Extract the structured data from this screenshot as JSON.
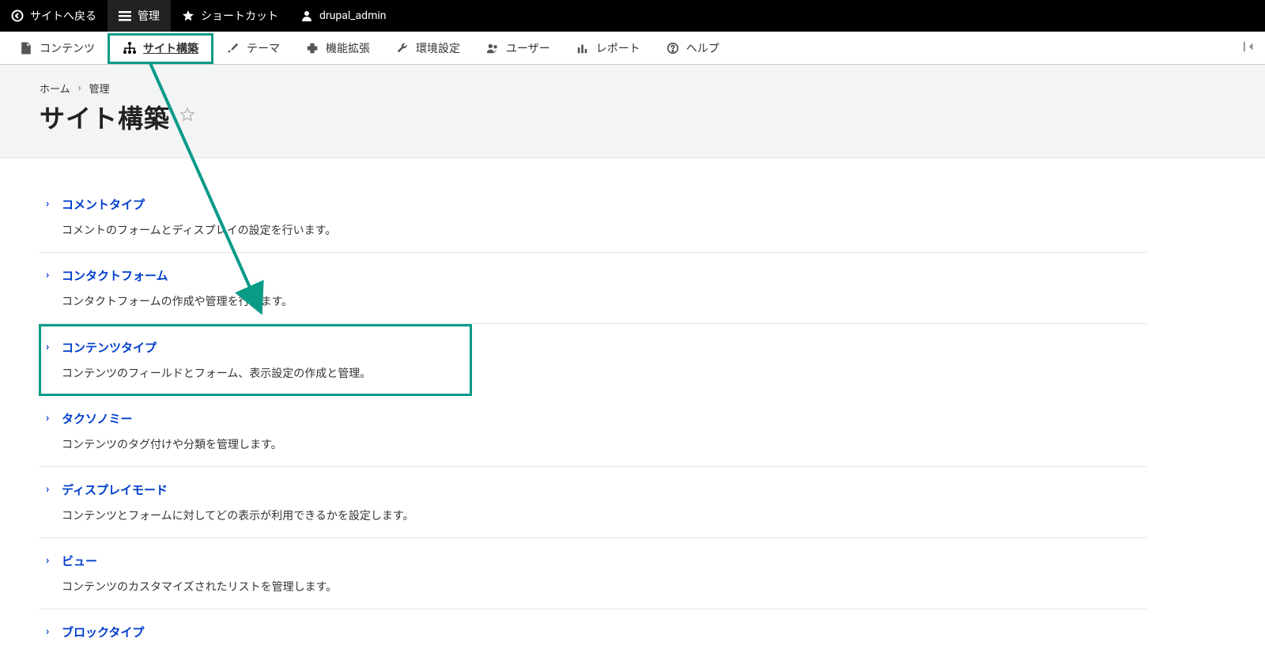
{
  "toolbar_top": {
    "back_to_site": "サイトへ戻る",
    "manage": "管理",
    "shortcuts": "ショートカット",
    "user": "drupal_admin"
  },
  "toolbar_admin": {
    "content": "コンテンツ",
    "structure": "サイト構築",
    "appearance": "テーマ",
    "extend": "機能拡張",
    "configuration": "環境設定",
    "people": "ユーザー",
    "reports": "レポート",
    "help": "ヘルプ"
  },
  "breadcrumb": {
    "home": "ホーム",
    "admin": "管理"
  },
  "page_title": "サイト構築",
  "list_items": [
    {
      "title": "コメントタイプ",
      "desc": "コメントのフォームとディスプレイの設定を行います。"
    },
    {
      "title": "コンタクトフォーム",
      "desc": "コンタクトフォームの作成や管理を行います。"
    },
    {
      "title": "コンテンツタイプ",
      "desc": "コンテンツのフィールドとフォーム、表示設定の作成と管理。"
    },
    {
      "title": "タクソノミー",
      "desc": "コンテンツのタグ付けや分類を管理します。"
    },
    {
      "title": "ディスプレイモード",
      "desc": "コンテンツとフォームに対してどの表示が利用できるかを設定します。"
    },
    {
      "title": "ビュー",
      "desc": "コンテンツのカスタマイズされたリストを管理します。"
    },
    {
      "title": "ブロックタイプ",
      "desc": ""
    }
  ],
  "annotation": {
    "highlight_color": "#0a9b87",
    "highlighted_tab_index": 1,
    "highlighted_item_index": 2
  }
}
